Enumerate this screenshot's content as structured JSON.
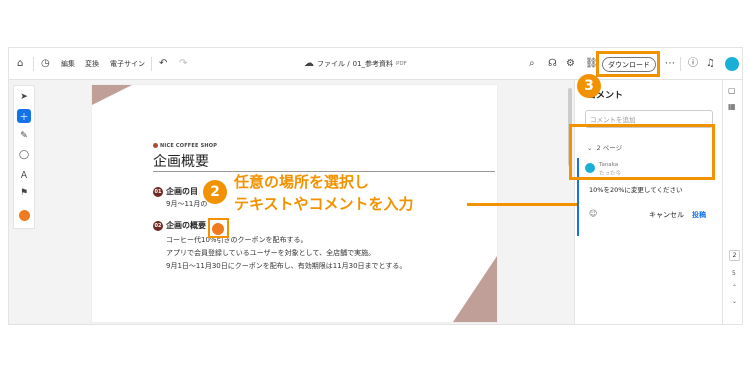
{
  "toolbar": {
    "edit": "編集",
    "convert": "変換",
    "esign": "電子サイン",
    "breadcrumb_prefix": "ファイル /",
    "file_name": "01_参考資料",
    "file_type": "PDF",
    "download": "ダウンロード",
    "icons": [
      "home-icon",
      "clock-icon",
      "undo-icon",
      "redo-icon",
      "cloud-icon",
      "search-icon",
      "headset-icon",
      "settings-icon",
      "link-icon",
      "more-icon",
      "help-icon",
      "bell-icon",
      "avatar"
    ]
  },
  "doc": {
    "logo": "NICE COFFEE SHOP",
    "title": "企画概要",
    "sections": [
      {
        "num": "01",
        "heading": "企画の目",
        "body": [
          "9月～11月の"
        ]
      },
      {
        "num": "02",
        "heading": "企画の概要",
        "body": [
          "コーヒー代10%引きのクーポンを配布する。",
          "アプリで会員登録しているユーザーを対象として、全店舗で実施。",
          "9月1日～11月30日にクーポンを配布し、有効期限は11月30日までとする。"
        ]
      }
    ]
  },
  "panel": {
    "title": "コメント",
    "add_placeholder": "コメントを追加",
    "page_label": "2 ページ",
    "user": "Tanaka",
    "time": "たった今",
    "input_value": "10%を20%に変更してください",
    "cancel": "キャンセル",
    "post": "投稿"
  },
  "rail": {
    "current_page": "2",
    "pages": [
      "5"
    ]
  },
  "callouts": {
    "step2": "2",
    "step3": "3",
    "line1": "任意の場所を選択し",
    "line2": "テキストやコメントを入力"
  },
  "colors": {
    "accent": "#f29200",
    "brand_blue": "#1473e6",
    "doc_brown": "#6e2a22"
  }
}
